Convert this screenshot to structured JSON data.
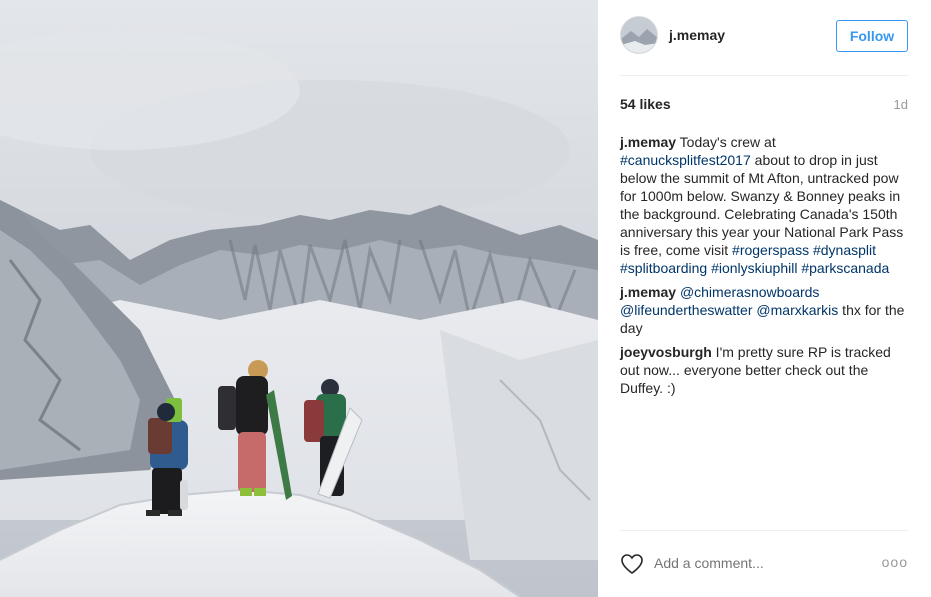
{
  "post": {
    "username": "j.memay",
    "follow_label": "Follow",
    "likes": "54 likes",
    "age": "1d"
  },
  "comments": [
    {
      "author": "j.memay",
      "segments": [
        {
          "type": "text",
          "text": " Today's crew at "
        },
        {
          "type": "link",
          "text": "#canucksplitfest2017"
        },
        {
          "type": "text",
          "text": " about to drop in just below the summit of Mt Afton, untracked pow for 1000m below. Swanzy & Bonney peaks in the background. Celebrating Canada's 150th anniversary this year your National Park Pass is free, come visit "
        },
        {
          "type": "link",
          "text": "#rogerspass"
        },
        {
          "type": "text",
          "text": " "
        },
        {
          "type": "link",
          "text": "#dynasplit"
        },
        {
          "type": "text",
          "text": " "
        },
        {
          "type": "link",
          "text": "#splitboarding"
        },
        {
          "type": "text",
          "text": " "
        },
        {
          "type": "link",
          "text": "#ionlyskiuphill"
        },
        {
          "type": "text",
          "text": " "
        },
        {
          "type": "link",
          "text": "#parkscanada"
        }
      ]
    },
    {
      "author": "j.memay",
      "segments": [
        {
          "type": "text",
          "text": " "
        },
        {
          "type": "link",
          "text": "@chimerasnowboards"
        },
        {
          "type": "text",
          "text": " "
        },
        {
          "type": "link",
          "text": "@lifeundertheswatter"
        },
        {
          "type": "text",
          "text": " "
        },
        {
          "type": "link",
          "text": "@marxkarkis"
        },
        {
          "type": "text",
          "text": " thx for the day"
        }
      ]
    },
    {
      "author": "joeyvosburgh",
      "segments": [
        {
          "type": "text",
          "text": " I'm pretty sure RP is tracked out now... everyone better check out the Duffey. :)"
        }
      ]
    }
  ],
  "footer": {
    "add_comment_placeholder": "Add a comment...",
    "more_label": "ooo",
    "heart_icon": "heart-outline-icon"
  },
  "colors": {
    "accent": "#3897f0",
    "link": "#003569",
    "muted": "#999999"
  }
}
